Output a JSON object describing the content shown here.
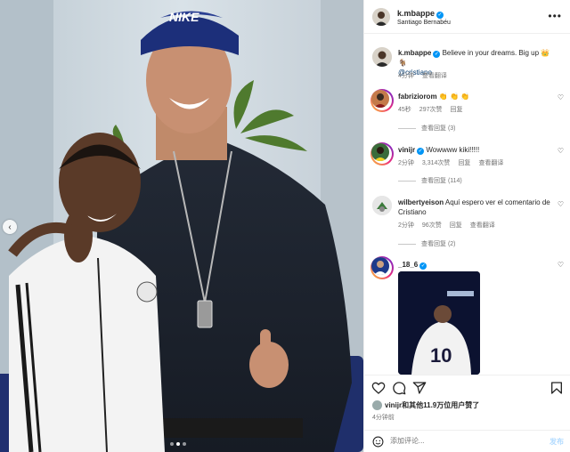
{
  "header": {
    "username": "k.mbappe",
    "location": "Santiago Bernabéu",
    "more_icon": "more-horizontal-icon"
  },
  "caption": {
    "username": "k.mbappe",
    "text": "Believe in your dreams. Big up 👑 🐐",
    "mention": "@cristiano",
    "time": "4分钟",
    "translate": "查看翻译"
  },
  "comments": [
    {
      "username": "fabriziorom",
      "text": "👏 👏 👏",
      "time": "45秒",
      "likes": "297次赞",
      "reply": "回复",
      "view_replies": "查看回复 (3)"
    },
    {
      "username": "vinijr",
      "text": "Wowwww kiki!!!!!",
      "time": "2分钟",
      "likes": "3,314次赞",
      "reply": "回复",
      "translate": "查看翻译",
      "view_replies": "查看回复 (114)"
    },
    {
      "username": "wilbertyeison",
      "text": "Aquí espero ver el comentario de Cristiano",
      "time": "2分钟",
      "likes": "96次赞",
      "reply": "回复",
      "translate": "查看翻译",
      "view_replies": "查看回复 (2)"
    },
    {
      "username": "_18_6"
    }
  ],
  "actions": {
    "liked_by_user": "vinijr",
    "liked_by_rest": "和其他11.9万位用户赞了",
    "time": "4分钟前"
  },
  "comment_input": {
    "placeholder": "添加评论...",
    "post_label": "发布"
  },
  "photo": {
    "jersey_number": "10",
    "carousel_total": 3,
    "carousel_active": 2
  },
  "colors": {
    "verified": "#0095f6",
    "link": "#00376b",
    "secondary_text": "#737373"
  }
}
